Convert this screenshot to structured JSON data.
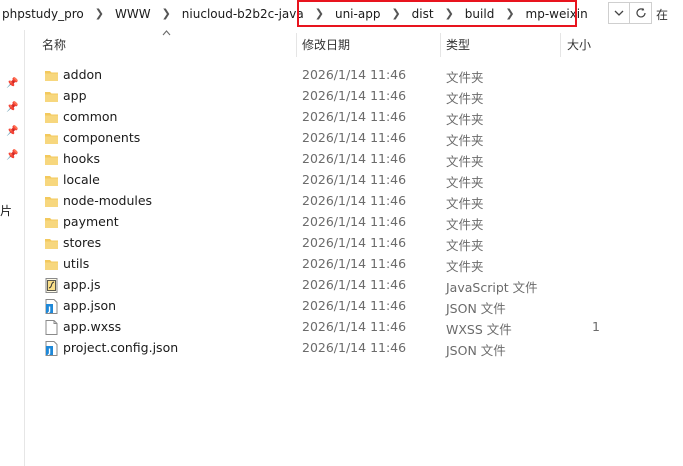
{
  "address": {
    "crumbs": [
      "phpstudy_pro",
      "WWW",
      "niucloud-b2b2c-java",
      "uni-app",
      "dist",
      "build",
      "mp-weixin"
    ],
    "dropdown_icon": "chevron-down-icon",
    "refresh_icon": "refresh-icon",
    "search_fragment": "在"
  },
  "nav": {
    "fragment_label": "片"
  },
  "columns": {
    "name": "名称",
    "date": "修改日期",
    "type": "类型",
    "size": "大小"
  },
  "files": [
    {
      "name": "addon",
      "date": "2026/1/14 11:46",
      "type": "文件夹",
      "size": "",
      "icon": "folder"
    },
    {
      "name": "app",
      "date": "2026/1/14 11:46",
      "type": "文件夹",
      "size": "",
      "icon": "folder"
    },
    {
      "name": "common",
      "date": "2026/1/14 11:46",
      "type": "文件夹",
      "size": "",
      "icon": "folder"
    },
    {
      "name": "components",
      "date": "2026/1/14 11:46",
      "type": "文件夹",
      "size": "",
      "icon": "folder"
    },
    {
      "name": "hooks",
      "date": "2026/1/14 11:46",
      "type": "文件夹",
      "size": "",
      "icon": "folder"
    },
    {
      "name": "locale",
      "date": "2026/1/14 11:46",
      "type": "文件夹",
      "size": "",
      "icon": "folder"
    },
    {
      "name": "node-modules",
      "date": "2026/1/14 11:46",
      "type": "文件夹",
      "size": "",
      "icon": "folder"
    },
    {
      "name": "payment",
      "date": "2026/1/14 11:46",
      "type": "文件夹",
      "size": "",
      "icon": "folder"
    },
    {
      "name": "stores",
      "date": "2026/1/14 11:46",
      "type": "文件夹",
      "size": "",
      "icon": "folder"
    },
    {
      "name": "utils",
      "date": "2026/1/14 11:46",
      "type": "文件夹",
      "size": "",
      "icon": "folder"
    },
    {
      "name": "app.js",
      "date": "2026/1/14 11:46",
      "type": "JavaScript 文件",
      "size": "",
      "icon": "js"
    },
    {
      "name": "app.json",
      "date": "2026/1/14 11:46",
      "type": "JSON 文件",
      "size": "",
      "icon": "json"
    },
    {
      "name": "app.wxss",
      "date": "2026/1/14 11:46",
      "type": "WXSS 文件",
      "size": "1",
      "icon": "blank"
    },
    {
      "name": "project.config.json",
      "date": "2026/1/14 11:46",
      "type": "JSON 文件",
      "size": "",
      "icon": "json"
    }
  ],
  "colors": {
    "highlight": "#e8141e",
    "folder": "#f3c95d",
    "json": "#1e88d8",
    "pin": "#2d63a8"
  }
}
